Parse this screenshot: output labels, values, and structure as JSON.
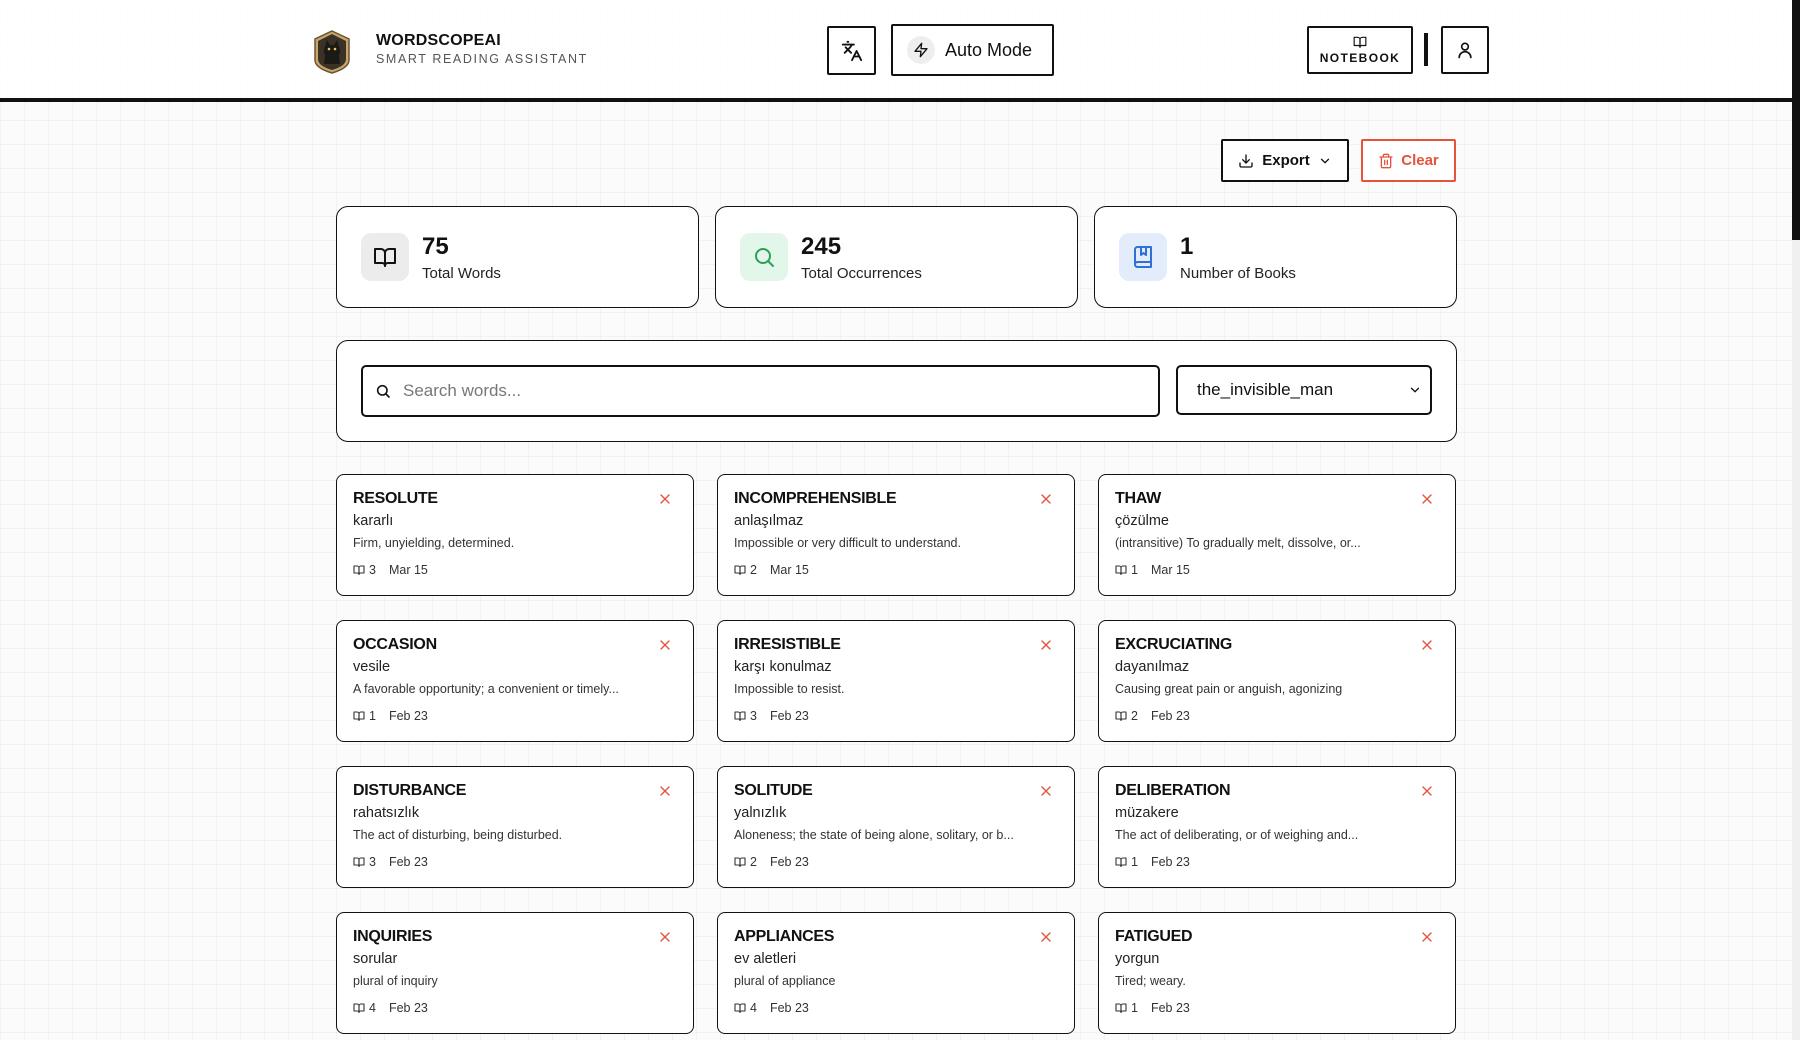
{
  "app": {
    "name": "WORDSCOPEAI",
    "subtitle": "SMART READING ASSISTANT"
  },
  "header": {
    "auto_mode_label": "Auto Mode",
    "notebook_label": "NOTEBOOK"
  },
  "actions": {
    "export_label": "Export",
    "clear_label": "Clear"
  },
  "stats": [
    {
      "value": "75",
      "label": "Total Words",
      "icon": "book-open-icon"
    },
    {
      "value": "245",
      "label": "Total Occurrences",
      "icon": "search-icon"
    },
    {
      "value": "1",
      "label": "Number of Books",
      "icon": "bookmark-book-icon"
    }
  ],
  "search": {
    "placeholder": "Search words...",
    "value": ""
  },
  "book_filter": {
    "selected": "the_invisible_man"
  },
  "words": [
    {
      "word": "RESOLUTE",
      "translation": "kararlı",
      "definition": "Firm, unyielding, determined.",
      "count": "3",
      "date": "Mar 15"
    },
    {
      "word": "INCOMPREHENSIBLE",
      "translation": "anlaşılmaz",
      "definition": "Impossible or very difficult to understand.",
      "count": "2",
      "date": "Mar 15"
    },
    {
      "word": "THAW",
      "translation": "çözülme",
      "definition": "(intransitive) To gradually melt, dissolve, or...",
      "count": "1",
      "date": "Mar 15"
    },
    {
      "word": "OCCASION",
      "translation": "vesile",
      "definition": "A favorable opportunity; a convenient or timely...",
      "count": "1",
      "date": "Feb 23"
    },
    {
      "word": "IRRESISTIBLE",
      "translation": "karşı konulmaz",
      "definition": "Impossible to resist.",
      "count": "3",
      "date": "Feb 23"
    },
    {
      "word": "EXCRUCIATING",
      "translation": "dayanılmaz",
      "definition": "Causing great pain or anguish, agonizing",
      "count": "2",
      "date": "Feb 23"
    },
    {
      "word": "DISTURBANCE",
      "translation": "rahatsızlık",
      "definition": "The act of disturbing, being disturbed.",
      "count": "3",
      "date": "Feb 23"
    },
    {
      "word": "SOLITUDE",
      "translation": "yalnızlık",
      "definition": "Aloneness; the state of being alone, solitary, or b...",
      "count": "2",
      "date": "Feb 23"
    },
    {
      "word": "DELIBERATION",
      "translation": "müzakere",
      "definition": "The act of deliberating, or of weighing and...",
      "count": "1",
      "date": "Feb 23"
    },
    {
      "word": "INQUIRIES",
      "translation": "sorular",
      "definition": "plural of inquiry",
      "count": "4",
      "date": "Feb 23"
    },
    {
      "word": "APPLIANCES",
      "translation": "ev aletleri",
      "definition": "plural of appliance",
      "count": "4",
      "date": "Feb 23"
    },
    {
      "word": "FATIGUED",
      "translation": "yorgun",
      "definition": "Tired; weary.",
      "count": "1",
      "date": "Feb 23"
    }
  ],
  "colors": {
    "accent": "#111111",
    "danger": "#e5533d",
    "occurrences_icon_bg": "#e3f6ea",
    "occurrences_icon": "#2f9e5a",
    "books_icon_bg": "#e2ecfb",
    "books_icon": "#2f6fd6",
    "words_icon_bg": "#ececec"
  }
}
